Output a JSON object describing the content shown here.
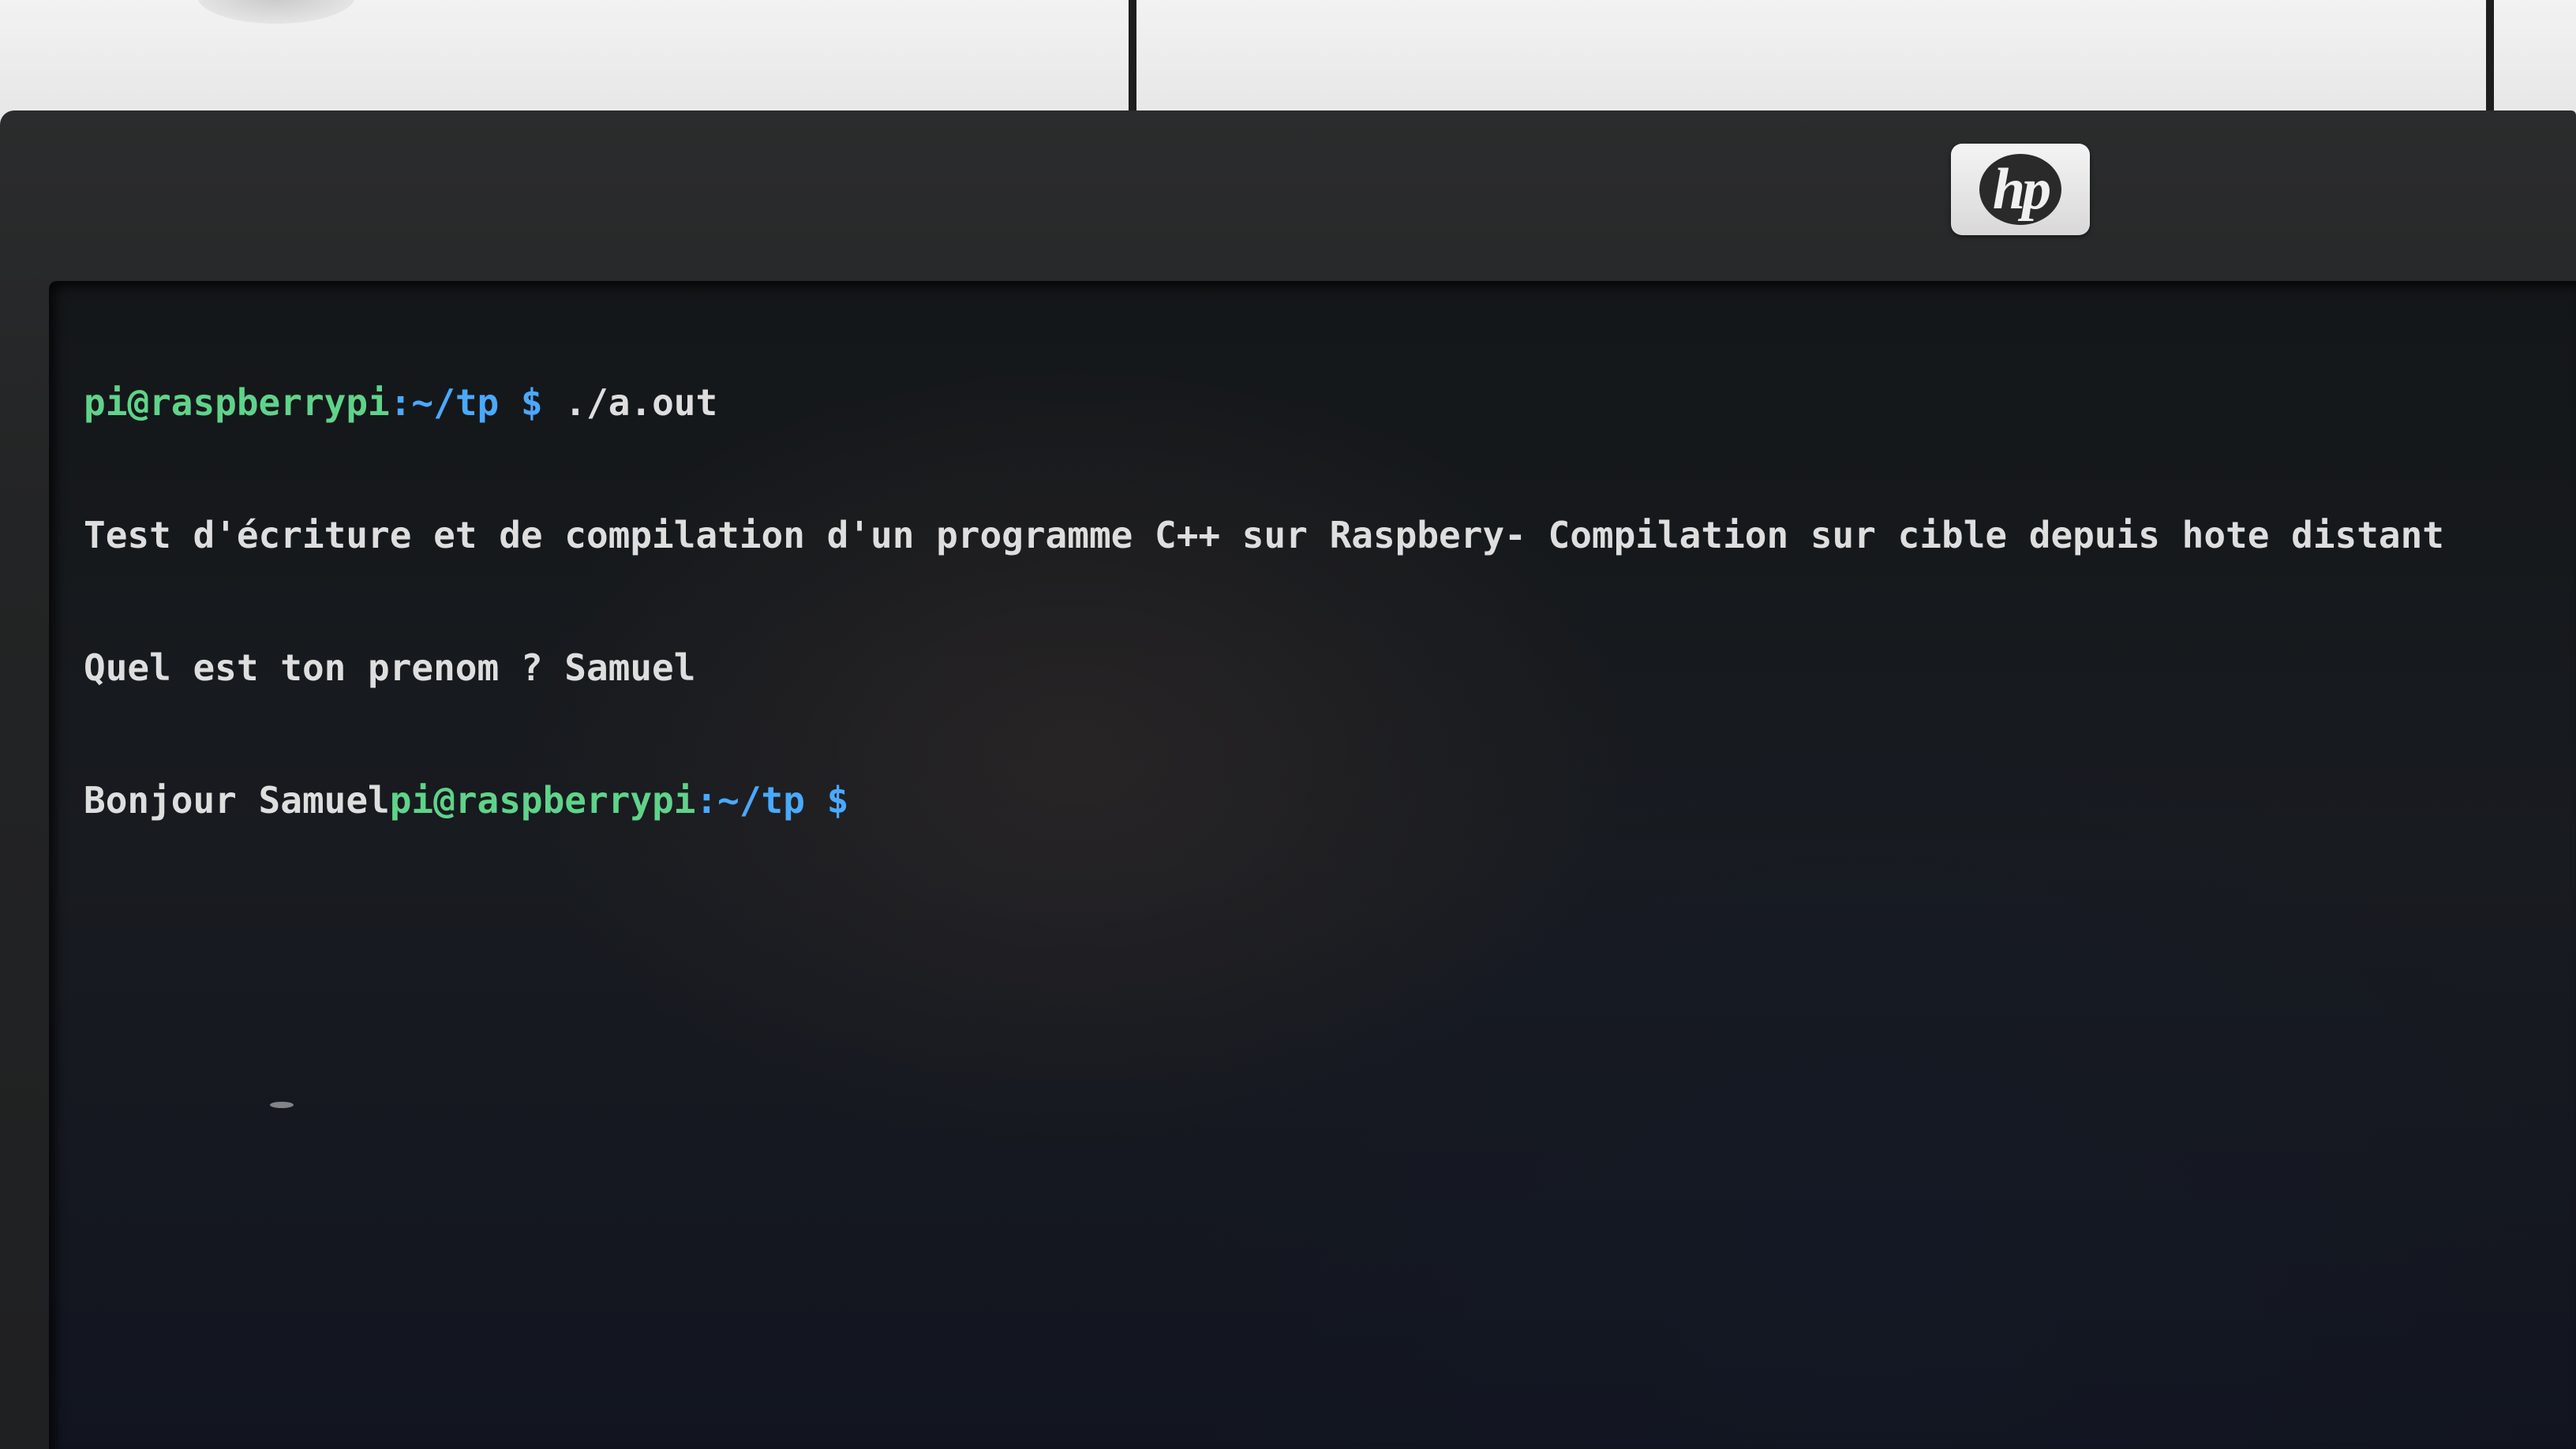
{
  "monitor": {
    "brand_logo": "hp"
  },
  "terminal": {
    "lines": [
      {
        "user_host": "pi@raspberrypi",
        "path": ":~/tp $",
        "command": " ./a.out"
      },
      {
        "text": "Test d'écriture et de compilation d'un programme C++ sur Raspbery- Compilation sur cible depuis hote distant"
      },
      {
        "text": "Quel est ton prenom ? Samuel"
      },
      {
        "output": "Bonjour Samuel",
        "user_host": "pi@raspberrypi",
        "path": ":~/tp $"
      }
    ]
  },
  "colors": {
    "prompt_user_host": "#5fd38a",
    "prompt_path": "#4aa9ff",
    "output_text": "#dedede",
    "screen_background": "#161a1e"
  }
}
